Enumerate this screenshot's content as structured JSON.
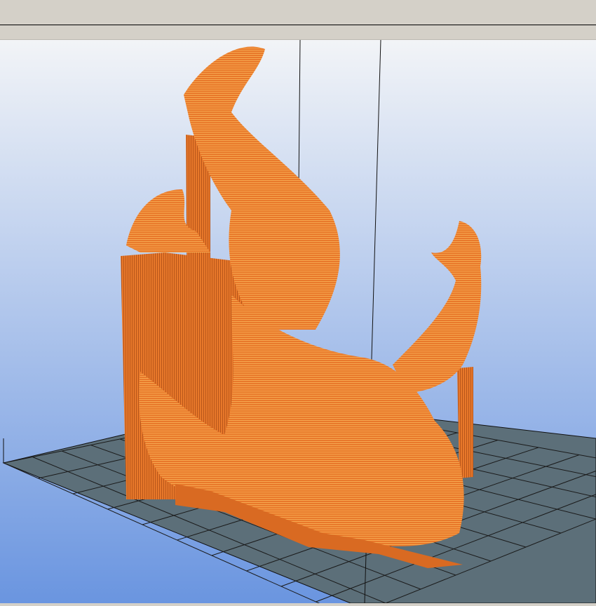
{
  "window": {
    "title": ""
  },
  "viewport": {
    "mode": "layer-preview",
    "background_top": "#f2f4f7",
    "background_bottom": "#6a95e0",
    "bed_color": "#5c6f79",
    "grid_color": "#1a1a1a",
    "model_color": "#e8782a",
    "model_highlight": "#f4a34a",
    "model_shadow": "#b8561a"
  }
}
